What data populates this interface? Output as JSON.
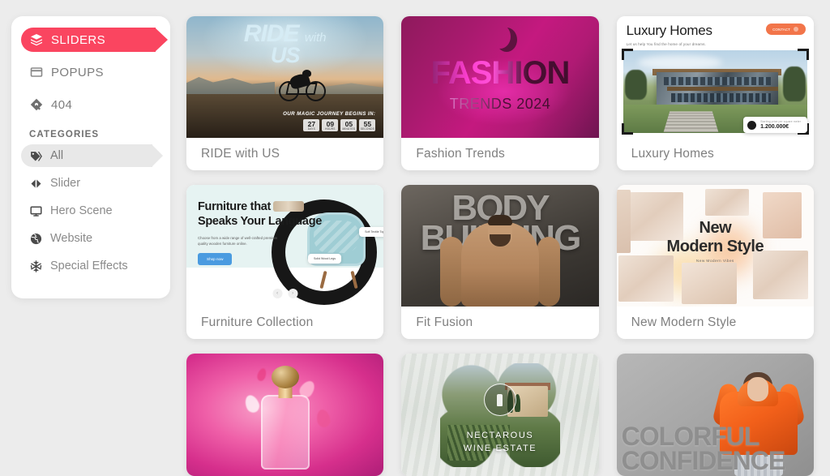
{
  "sidebar": {
    "nav": [
      {
        "label": "SLIDERS",
        "icon": "layers-icon",
        "active": true
      },
      {
        "label": "POPUPS",
        "icon": "window-icon",
        "active": false
      },
      {
        "label": "404",
        "icon": "diamond-icon",
        "active": false
      }
    ],
    "categories_heading": "CATEGORIES",
    "categories": [
      {
        "label": "All",
        "icon": "tag-icon",
        "selected": true
      },
      {
        "label": "Slider",
        "icon": "left-right-arrows-icon",
        "selected": false
      },
      {
        "label": "Hero Scene",
        "icon": "monitor-icon",
        "selected": false
      },
      {
        "label": "Website",
        "icon": "globe-icon",
        "selected": false
      },
      {
        "label": "Special Effects",
        "icon": "snowflake-icon",
        "selected": false
      }
    ]
  },
  "colors": {
    "accent": "#fa4560",
    "page_background": "#ececec",
    "card_background": "#ffffff",
    "selected_category": "#e8e8e8",
    "luxury_button": "#f2754a",
    "furniture_button": "#4a9be0"
  },
  "cards": [
    {
      "title": "RIDE with US",
      "preview": {
        "headline_main": "RIDE",
        "headline_small": "with",
        "headline_second": "US",
        "countdown_label": "OUR MAGIC JOURNEY BEGINS IN:",
        "countdown": [
          {
            "value": "27",
            "unit": "DAYS"
          },
          {
            "value": "09",
            "unit": "HOURS"
          },
          {
            "value": "05",
            "unit": "MINUTES"
          },
          {
            "value": "55",
            "unit": "SECONDS"
          }
        ]
      }
    },
    {
      "title": "Fashion Trends",
      "preview": {
        "headline": "FASHION",
        "subheadline": "TRENDS 2024"
      }
    },
    {
      "title": "Luxury Homes",
      "preview": {
        "headline": "Luxury Homes",
        "subheadline": "Let us help You find the home of your dreams.",
        "button_label": "CONTACT",
        "price_caption": "Starting price per square meter",
        "price_value": "1.200.000€"
      }
    },
    {
      "title": "Furniture Collection",
      "preview": {
        "headline_line1": "Furniture that",
        "headline_line2": "Speaks Your Language",
        "subheadline": "Choose from a wide range of well-crafted premium quality wooden furniture online.",
        "button_label": "Shop now",
        "chip1": "Solid Wood Legs",
        "chip2": "Soft Textile Top",
        "prev_arrow": "‹",
        "next_arrow": "›"
      }
    },
    {
      "title": "Fit Fusion",
      "preview": {
        "headline_line1": "BODY",
        "headline_line2": "BUILDING"
      }
    },
    {
      "title": "New Modern Style",
      "preview": {
        "headline_line1": "New",
        "headline_line2": "Modern Style",
        "subheadline": "New Modern Vibes"
      }
    },
    {
      "title": "",
      "preview": {}
    },
    {
      "title": "",
      "preview": {
        "headline_line1": "NECTAROUS",
        "headline_line2": "WINE ESTATE"
      }
    },
    {
      "title": "",
      "preview": {
        "headline_line1": "COLORFUL",
        "headline_line2": "CONFIDENCE"
      }
    }
  ]
}
